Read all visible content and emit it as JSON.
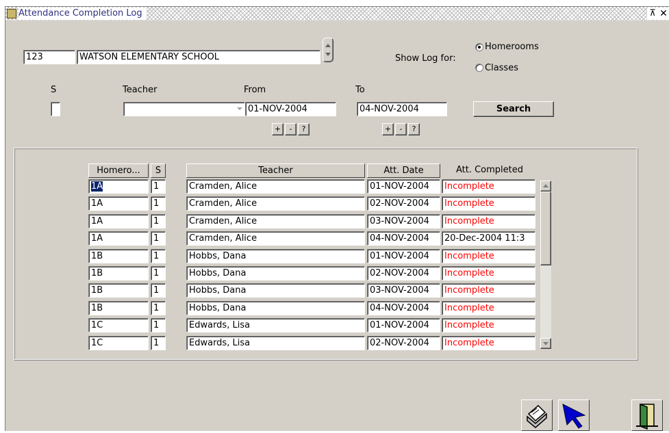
{
  "window": {
    "title": "Attendance Completion Log",
    "restore_glyph": "⊼",
    "close_glyph": "✕"
  },
  "school": {
    "code": "123",
    "name": "WATSON ELEMENTARY SCHOOL"
  },
  "show_log": {
    "label": "Show Log for:",
    "options": [
      {
        "label": "Homerooms",
        "selected": true
      },
      {
        "label": "Classes",
        "selected": false
      }
    ]
  },
  "filters": {
    "s_label": "S",
    "teacher_label": "Teacher",
    "teacher_value": "",
    "from_label": "From",
    "from_value": "01-NOV-2004",
    "to_label": "To",
    "to_value": "04-NOV-2004",
    "plus": "+",
    "minus": "-",
    "help": "?",
    "search_label": "Search"
  },
  "table": {
    "headers": {
      "homeroom": "Homero...",
      "s": "S",
      "teacher": "Teacher",
      "att_date": "Att. Date",
      "att_completed": "Att. Completed"
    },
    "rows": [
      {
        "homeroom": "1A",
        "s": "1",
        "teacher": "Cramden, Alice",
        "date": "01-NOV-2004",
        "completed": "Incomplete"
      },
      {
        "homeroom": "1A",
        "s": "1",
        "teacher": "Cramden, Alice",
        "date": "02-NOV-2004",
        "completed": "Incomplete"
      },
      {
        "homeroom": "1A",
        "s": "1",
        "teacher": "Cramden, Alice",
        "date": "03-NOV-2004",
        "completed": "Incomplete"
      },
      {
        "homeroom": "1A",
        "s": "1",
        "teacher": "Cramden, Alice",
        "date": "04-NOV-2004",
        "completed": "20-Dec-2004 11:3"
      },
      {
        "homeroom": "1B",
        "s": "1",
        "teacher": "Hobbs, Dana",
        "date": "01-NOV-2004",
        "completed": "Incomplete"
      },
      {
        "homeroom": "1B",
        "s": "1",
        "teacher": "Hobbs, Dana",
        "date": "02-NOV-2004",
        "completed": "Incomplete"
      },
      {
        "homeroom": "1B",
        "s": "1",
        "teacher": "Hobbs, Dana",
        "date": "03-NOV-2004",
        "completed": "Incomplete"
      },
      {
        "homeroom": "1B",
        "s": "1",
        "teacher": "Hobbs, Dana",
        "date": "04-NOV-2004",
        "completed": "Incomplete"
      },
      {
        "homeroom": "1C",
        "s": "1",
        "teacher": "Edwards, Lisa",
        "date": "01-NOV-2004",
        "completed": "Incomplete"
      },
      {
        "homeroom": "1C",
        "s": "1",
        "teacher": "Edwards, Lisa",
        "date": "02-NOV-2004",
        "completed": "Incomplete"
      }
    ]
  },
  "colors": {
    "incomplete": "#ff0000",
    "selection": "#0a246a",
    "window_bg": "#d4d0c8"
  },
  "toolbar_icons": [
    "print-icon",
    "pointer-arrow-icon",
    "exit-door-icon"
  ]
}
